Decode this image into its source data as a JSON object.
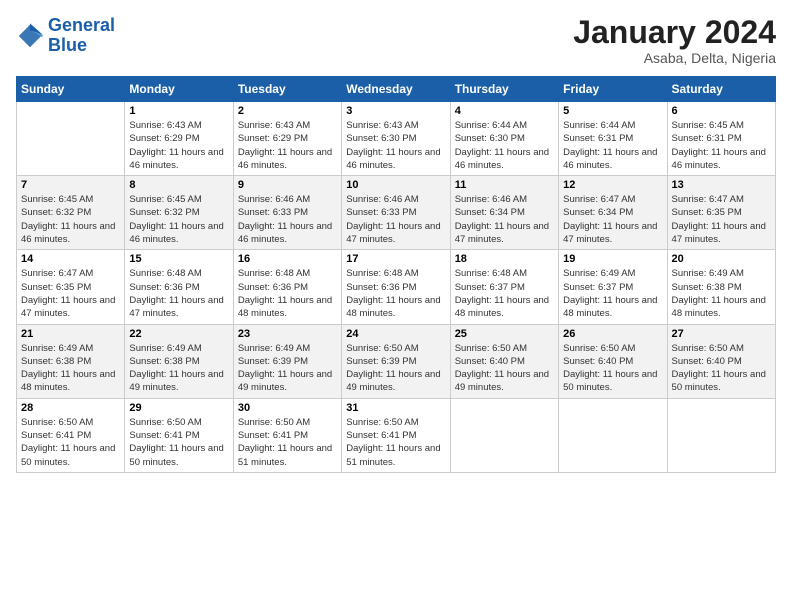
{
  "logo": {
    "line1": "General",
    "line2": "Blue"
  },
  "title": "January 2024",
  "location": "Asaba, Delta, Nigeria",
  "days_of_week": [
    "Sunday",
    "Monday",
    "Tuesday",
    "Wednesday",
    "Thursday",
    "Friday",
    "Saturday"
  ],
  "weeks": [
    [
      {
        "day": "",
        "sunrise": "",
        "sunset": "",
        "daylight": ""
      },
      {
        "day": "1",
        "sunrise": "Sunrise: 6:43 AM",
        "sunset": "Sunset: 6:29 PM",
        "daylight": "Daylight: 11 hours and 46 minutes."
      },
      {
        "day": "2",
        "sunrise": "Sunrise: 6:43 AM",
        "sunset": "Sunset: 6:29 PM",
        "daylight": "Daylight: 11 hours and 46 minutes."
      },
      {
        "day": "3",
        "sunrise": "Sunrise: 6:43 AM",
        "sunset": "Sunset: 6:30 PM",
        "daylight": "Daylight: 11 hours and 46 minutes."
      },
      {
        "day": "4",
        "sunrise": "Sunrise: 6:44 AM",
        "sunset": "Sunset: 6:30 PM",
        "daylight": "Daylight: 11 hours and 46 minutes."
      },
      {
        "day": "5",
        "sunrise": "Sunrise: 6:44 AM",
        "sunset": "Sunset: 6:31 PM",
        "daylight": "Daylight: 11 hours and 46 minutes."
      },
      {
        "day": "6",
        "sunrise": "Sunrise: 6:45 AM",
        "sunset": "Sunset: 6:31 PM",
        "daylight": "Daylight: 11 hours and 46 minutes."
      }
    ],
    [
      {
        "day": "7",
        "sunrise": "Sunrise: 6:45 AM",
        "sunset": "Sunset: 6:32 PM",
        "daylight": "Daylight: 11 hours and 46 minutes."
      },
      {
        "day": "8",
        "sunrise": "Sunrise: 6:45 AM",
        "sunset": "Sunset: 6:32 PM",
        "daylight": "Daylight: 11 hours and 46 minutes."
      },
      {
        "day": "9",
        "sunrise": "Sunrise: 6:46 AM",
        "sunset": "Sunset: 6:33 PM",
        "daylight": "Daylight: 11 hours and 46 minutes."
      },
      {
        "day": "10",
        "sunrise": "Sunrise: 6:46 AM",
        "sunset": "Sunset: 6:33 PM",
        "daylight": "Daylight: 11 hours and 47 minutes."
      },
      {
        "day": "11",
        "sunrise": "Sunrise: 6:46 AM",
        "sunset": "Sunset: 6:34 PM",
        "daylight": "Daylight: 11 hours and 47 minutes."
      },
      {
        "day": "12",
        "sunrise": "Sunrise: 6:47 AM",
        "sunset": "Sunset: 6:34 PM",
        "daylight": "Daylight: 11 hours and 47 minutes."
      },
      {
        "day": "13",
        "sunrise": "Sunrise: 6:47 AM",
        "sunset": "Sunset: 6:35 PM",
        "daylight": "Daylight: 11 hours and 47 minutes."
      }
    ],
    [
      {
        "day": "14",
        "sunrise": "Sunrise: 6:47 AM",
        "sunset": "Sunset: 6:35 PM",
        "daylight": "Daylight: 11 hours and 47 minutes."
      },
      {
        "day": "15",
        "sunrise": "Sunrise: 6:48 AM",
        "sunset": "Sunset: 6:36 PM",
        "daylight": "Daylight: 11 hours and 47 minutes."
      },
      {
        "day": "16",
        "sunrise": "Sunrise: 6:48 AM",
        "sunset": "Sunset: 6:36 PM",
        "daylight": "Daylight: 11 hours and 48 minutes."
      },
      {
        "day": "17",
        "sunrise": "Sunrise: 6:48 AM",
        "sunset": "Sunset: 6:36 PM",
        "daylight": "Daylight: 11 hours and 48 minutes."
      },
      {
        "day": "18",
        "sunrise": "Sunrise: 6:48 AM",
        "sunset": "Sunset: 6:37 PM",
        "daylight": "Daylight: 11 hours and 48 minutes."
      },
      {
        "day": "19",
        "sunrise": "Sunrise: 6:49 AM",
        "sunset": "Sunset: 6:37 PM",
        "daylight": "Daylight: 11 hours and 48 minutes."
      },
      {
        "day": "20",
        "sunrise": "Sunrise: 6:49 AM",
        "sunset": "Sunset: 6:38 PM",
        "daylight": "Daylight: 11 hours and 48 minutes."
      }
    ],
    [
      {
        "day": "21",
        "sunrise": "Sunrise: 6:49 AM",
        "sunset": "Sunset: 6:38 PM",
        "daylight": "Daylight: 11 hours and 48 minutes."
      },
      {
        "day": "22",
        "sunrise": "Sunrise: 6:49 AM",
        "sunset": "Sunset: 6:38 PM",
        "daylight": "Daylight: 11 hours and 49 minutes."
      },
      {
        "day": "23",
        "sunrise": "Sunrise: 6:49 AM",
        "sunset": "Sunset: 6:39 PM",
        "daylight": "Daylight: 11 hours and 49 minutes."
      },
      {
        "day": "24",
        "sunrise": "Sunrise: 6:50 AM",
        "sunset": "Sunset: 6:39 PM",
        "daylight": "Daylight: 11 hours and 49 minutes."
      },
      {
        "day": "25",
        "sunrise": "Sunrise: 6:50 AM",
        "sunset": "Sunset: 6:40 PM",
        "daylight": "Daylight: 11 hours and 49 minutes."
      },
      {
        "day": "26",
        "sunrise": "Sunrise: 6:50 AM",
        "sunset": "Sunset: 6:40 PM",
        "daylight": "Daylight: 11 hours and 50 minutes."
      },
      {
        "day": "27",
        "sunrise": "Sunrise: 6:50 AM",
        "sunset": "Sunset: 6:40 PM",
        "daylight": "Daylight: 11 hours and 50 minutes."
      }
    ],
    [
      {
        "day": "28",
        "sunrise": "Sunrise: 6:50 AM",
        "sunset": "Sunset: 6:41 PM",
        "daylight": "Daylight: 11 hours and 50 minutes."
      },
      {
        "day": "29",
        "sunrise": "Sunrise: 6:50 AM",
        "sunset": "Sunset: 6:41 PM",
        "daylight": "Daylight: 11 hours and 50 minutes."
      },
      {
        "day": "30",
        "sunrise": "Sunrise: 6:50 AM",
        "sunset": "Sunset: 6:41 PM",
        "daylight": "Daylight: 11 hours and 51 minutes."
      },
      {
        "day": "31",
        "sunrise": "Sunrise: 6:50 AM",
        "sunset": "Sunset: 6:41 PM",
        "daylight": "Daylight: 11 hours and 51 minutes."
      },
      {
        "day": "",
        "sunrise": "",
        "sunset": "",
        "daylight": ""
      },
      {
        "day": "",
        "sunrise": "",
        "sunset": "",
        "daylight": ""
      },
      {
        "day": "",
        "sunrise": "",
        "sunset": "",
        "daylight": ""
      }
    ]
  ]
}
